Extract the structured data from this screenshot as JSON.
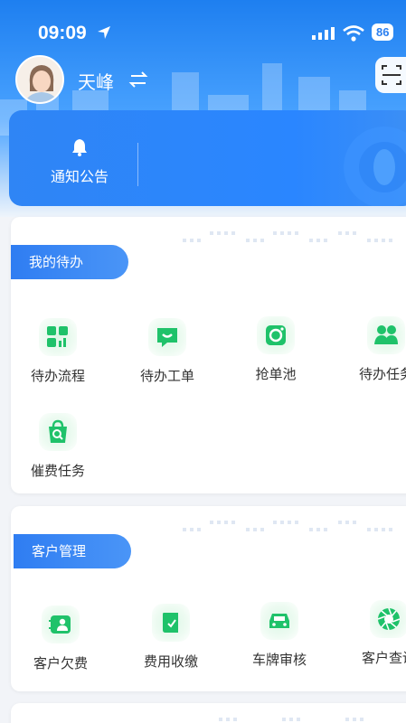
{
  "status_bar": {
    "time": "09:09",
    "battery": "86"
  },
  "user": {
    "name": "天峰"
  },
  "notice": {
    "label": "通知公告"
  },
  "sections": [
    {
      "title": "我的待办",
      "items": [
        {
          "label": "待办流程",
          "icon": "workflow-grid-icon"
        },
        {
          "label": "待办工单",
          "icon": "message-ticket-icon"
        },
        {
          "label": "抢单池",
          "icon": "camera-grab-icon"
        },
        {
          "label": "待办任务",
          "icon": "people-task-icon"
        },
        {
          "label": "催费任务",
          "icon": "bag-search-icon"
        }
      ]
    },
    {
      "title": "客户管理",
      "items": [
        {
          "label": "客户欠费",
          "icon": "customer-card-icon"
        },
        {
          "label": "费用收缴",
          "icon": "book-fee-icon"
        },
        {
          "label": "车牌审核",
          "icon": "car-icon"
        },
        {
          "label": "客户查询",
          "icon": "aperture-search-icon"
        }
      ]
    }
  ],
  "colors": {
    "primary": "#2f7df2",
    "icon_green": "#1fc26a",
    "text": "#333333"
  }
}
